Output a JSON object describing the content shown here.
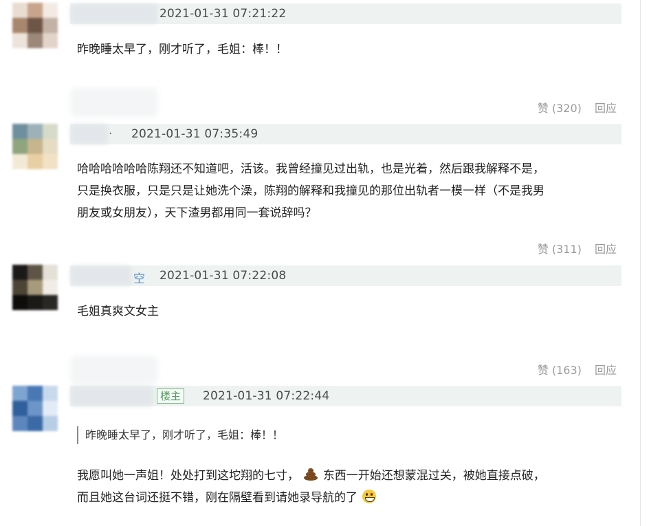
{
  "comments": [
    {
      "timestamp": "2021-01-31 07:21:22",
      "text_lines": [
        "昨晚睡太早了，刚才听了，毛姐：棒！！"
      ],
      "like_label": "赞 (320)",
      "reply_label": "回应",
      "avatar_colors": [
        "#e9ddd2",
        "#c9a48c",
        "#f3eae3",
        "#a8876f",
        "#6e5646",
        "#c3b2a6",
        "#eee3da",
        "#9c8778",
        "#e2d4c9"
      ]
    },
    {
      "name_suffix": "·",
      "timestamp": "2021-01-31 07:35:49",
      "text_lines": [
        "哈哈哈哈哈哈陈翔还不知道吧，活该。我曾经撞见过出轨，也是光着，然后跟我解释不是，",
        "只是换衣服，只是只是让她洗个澡，陈翔的解释和我撞见的那位出轨者一模一样（不是我男",
        "朋友或女朋友），天下渣男都用同一套说辞吗？"
      ],
      "like_label": "赞 (311)",
      "reply_label": "回应",
      "avatar_colors": [
        "#6f8f9e",
        "#9cb2b8",
        "#d6dbc9",
        "#8fa57e",
        "#c7b58d",
        "#e6dcc3",
        "#f3ead6",
        "#e8cfa4",
        "#f2e1c4"
      ]
    },
    {
      "name_suffix": "空",
      "timestamp": "2021-01-31 07:22:08",
      "text_lines": [
        "毛姐真爽文女主"
      ],
      "like_label": "赞 (163)",
      "reply_label": "回应",
      "avatar_colors": [
        "#1c1a18",
        "#5f5546",
        "#e4e0d8",
        "#4c4535",
        "#a89b7c",
        "#f1ede6",
        "#0e0d0c",
        "#1b1a18",
        "#2a2825"
      ]
    },
    {
      "op_tag": "楼主",
      "timestamp": "2021-01-31 07:22:44",
      "quoted_text": "昨晚睡太早了，刚才听了，毛姐：棒！！",
      "text_line1_a": "我愿叫她一声姐！处处打到这坨翔的七寸，",
      "poop_emoji": "poop-emoji-icon",
      "text_line1_b": "东西一开始还想蒙混过关，被她直接点破，",
      "text_line2": "而且她这台词还挺不错，刚在隔壁看到请她录导航的了",
      "grin_emoji": "grinning-emoji-icon",
      "avatar_colors": [
        "#7ea4d0",
        "#4a78b5",
        "#c9d9ec",
        "#2f5f9c",
        "#6d95c8",
        "#e3ecf6",
        "#5d86bd",
        "#3b6aa6",
        "#b8cde6"
      ]
    }
  ]
}
